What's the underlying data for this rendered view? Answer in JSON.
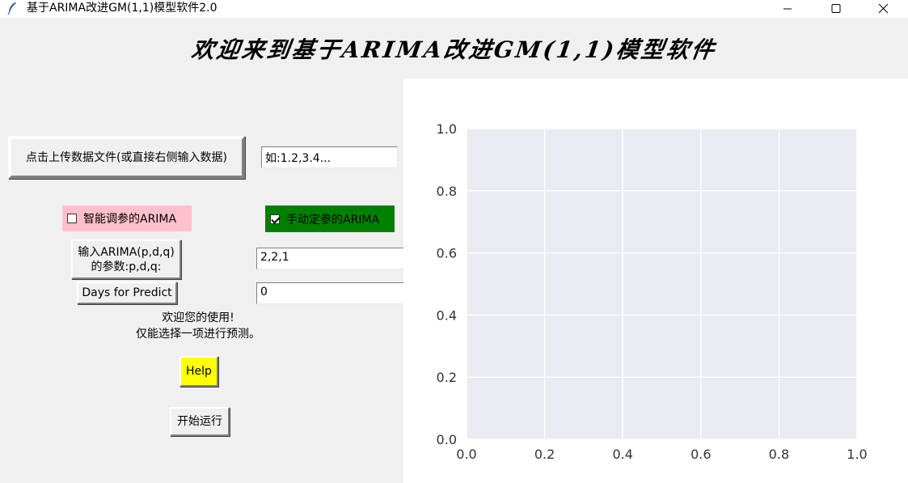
{
  "window": {
    "title": "基于ARIMA改进GM(1,1)模型软件2.0",
    "icon": "feather-icon",
    "controls": [
      "minimize-icon",
      "maximize-icon",
      "close-icon"
    ]
  },
  "heading": "欢迎来到基于ARIMA改进GM(1,1)模型软件",
  "upload": {
    "button_label": "点击上传数据文件(或直接右侧输入数据)",
    "data_value": "如:1.2,3.4..."
  },
  "options": {
    "smart_label": "智能调参的ARIMA",
    "smart_checked": false,
    "smart_color": "#ffc0cb",
    "manual_label": "手动定参的ARIMA",
    "manual_checked": true,
    "manual_color": "#008000"
  },
  "params": {
    "arima_button_line1": "输入ARIMA(p,d,q)",
    "arima_button_line2": "的参数:p,d,q:",
    "pdq_value": "2,2,1",
    "days_button_label": "Days for Predict",
    "days_value": "0"
  },
  "status": {
    "line1": "欢迎您的使用!",
    "line2": "仅能选择一项进行预测。"
  },
  "buttons": {
    "help_label": "Help",
    "help_color": "#ffff00",
    "run_label": "开始运行"
  },
  "chart_data": {
    "type": "line",
    "series": [],
    "xlim": [
      0.0,
      1.0
    ],
    "ylim": [
      0.0,
      1.0
    ],
    "x_ticks": [
      "0.0",
      "0.2",
      "0.4",
      "0.6",
      "0.8",
      "1.0"
    ],
    "y_ticks": [
      "0.0",
      "0.2",
      "0.4",
      "0.6",
      "0.8",
      "1.0"
    ],
    "grid": true,
    "plot_background": "#eaeaf2",
    "grid_color": "#ffffff"
  }
}
